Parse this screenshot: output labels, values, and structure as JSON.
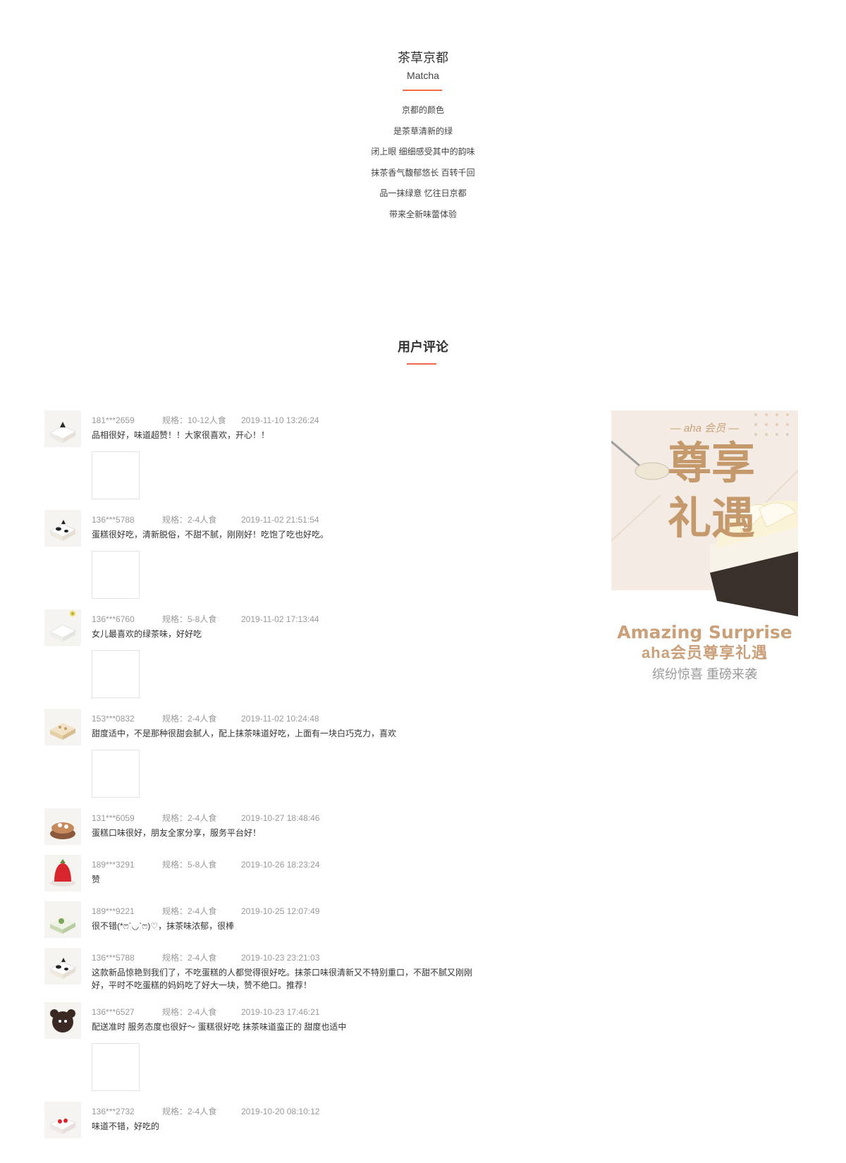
{
  "product": {
    "title": "茶草京都",
    "subtitle": "Matcha",
    "lines": [
      "京都的颜色",
      "是茶草清新的绿",
      "闭上眼 细细感受其中的韵味",
      "抹茶香气馥郁悠长 百转千回",
      "品一抹绿意 忆往日京都",
      "带来全新味蕾体验"
    ]
  },
  "reviews": {
    "heading": "用户评论",
    "items": [
      {
        "user": "181***2659",
        "spec": "规格：10-12人食",
        "time": "2019-11-10 13:26:24",
        "text": "品相很好，味道超赞！！大家很喜欢，开心！！",
        "has_photo": true,
        "cake": "white-black"
      },
      {
        "user": "136***5788",
        "spec": "规格：2-4人食",
        "time": "2019-11-02 21:51:54",
        "text": "蛋糕很好吃，清新脱俗，不甜不腻，刚刚好！吃饱了吃也好吃。",
        "has_photo": true,
        "cake": "cow"
      },
      {
        "user": "136***6760",
        "spec": "规格：5-8人食",
        "time": "2019-11-02 17:13:44",
        "text": "女儿最喜欢的绿茶味，好好吃",
        "has_photo": true,
        "cake": "white-flower"
      },
      {
        "user": "153***0832",
        "spec": "规格：2-4人食",
        "time": "2019-11-02 10:24:48",
        "text": "甜度适中，不是那种很甜会腻人，配上抹茶味道好吃，上面有一块白巧克力，喜欢",
        "has_photo": true,
        "cake": "crumb"
      },
      {
        "user": "131***6059",
        "spec": "规格：2-4人食",
        "time": "2019-10-27 18:48:46",
        "text": "蛋糕口味很好，朋友全家分享，服务平台好！",
        "has_photo": false,
        "cake": "brown"
      },
      {
        "user": "189***3291",
        "spec": "规格：5-8人食",
        "time": "2019-10-26 18:23:24",
        "text": "赞",
        "has_photo": false,
        "cake": "strawberry"
      },
      {
        "user": "189***9221",
        "spec": "规格：2-4人食",
        "time": "2019-10-25 12:07:49",
        "text": "很不错(*ෆ´◡`ෆ)♡，抹茶味浓郁，很棒",
        "has_photo": false,
        "cake": "matcha"
      },
      {
        "user": "136***5788",
        "spec": "规格：2-4人食",
        "time": "2019-10-23 23:21:03",
        "text": "这款新品惊艳到我们了，不吃蛋糕的人都觉得很好吃。抹茶口味很清新又不特别重口，不甜不腻又刚刚好，平时不吃蛋糕的妈妈吃了好大一块，赞不绝口。推荐！",
        "has_photo": false,
        "cake": "cow"
      },
      {
        "user": "136***6527",
        "spec": "规格：2-4人食",
        "time": "2019-10-23 17:46:21",
        "text": "配送准时 服务态度也很好～ 蛋糕很好吃 抹茶味道蛮正的 甜度也适中",
        "has_photo": true,
        "cake": "bear"
      },
      {
        "user": "136***2732",
        "spec": "规格：2-4人食",
        "time": "2019-10-20 08:10:12",
        "text": "味道不错，好吃的",
        "has_photo": false,
        "cake": "berry-white"
      }
    ]
  },
  "promo": {
    "badge": "— aha 会员 —",
    "big_1": "尊享",
    "big_2": "礼遇",
    "title_en": "Amazing Surprise",
    "title_cn": "aha会员尊享礼遇",
    "tagline": "缤纷惊喜 重磅来袭",
    "colors": {
      "gold": "#c9a079",
      "panel": "#f4ebe4",
      "accent_rule": "#f26a4b"
    }
  }
}
